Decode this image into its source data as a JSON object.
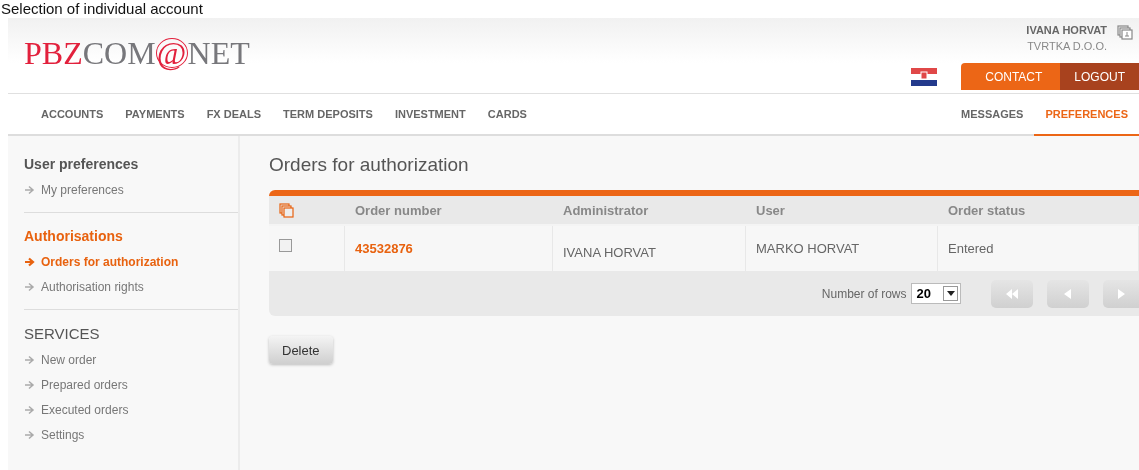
{
  "caption": "Selection of individual account",
  "logo": [
    {
      "text": "PBZ",
      "color": "#e2203c"
    },
    {
      "text": "COM",
      "color": "#77777b"
    },
    {
      "text": "@",
      "color": "#e2203c"
    },
    {
      "text": "NET",
      "color": "#77777b"
    }
  ],
  "user": {
    "name": "IVANA HORVAT",
    "company": "TVRTKA D.O.O."
  },
  "top_buttons": [
    {
      "label": "CONTACT",
      "kind": "contact"
    },
    {
      "label": "LOGOUT",
      "kind": "logout"
    }
  ],
  "nav_left": [
    {
      "label": "ACCOUNTS",
      "selected": false
    },
    {
      "label": "PAYMENTS",
      "selected": false
    },
    {
      "label": "FX DEALS",
      "selected": false
    },
    {
      "label": "TERM DEPOSITS",
      "selected": false
    },
    {
      "label": "INVESTMENT",
      "selected": false
    },
    {
      "label": "CARDS",
      "selected": false
    }
  ],
  "nav_right": [
    {
      "label": "MESSAGES",
      "selected": false
    },
    {
      "label": "PREFERENCES",
      "selected": true
    }
  ],
  "sidebar": [
    {
      "title": "User preferences",
      "selected": false,
      "items": [
        {
          "label": "My preferences",
          "selected": false
        }
      ]
    },
    {
      "title": "Authorisations",
      "selected": true,
      "items": [
        {
          "label": "Orders for authorization",
          "selected": true
        },
        {
          "label": "Authorisation rights",
          "selected": false
        }
      ]
    },
    {
      "title": "SERVICES",
      "selected": false,
      "items": [
        {
          "label": "New order",
          "selected": false
        },
        {
          "label": "Prepared orders",
          "selected": false
        },
        {
          "label": "Executed orders",
          "selected": false
        },
        {
          "label": "Settings",
          "selected": false
        }
      ]
    }
  ],
  "page_title": "Orders for authorization",
  "table": {
    "columns": [
      "Order number",
      "Administrator",
      "User",
      "Order status"
    ],
    "rows": [
      {
        "checked": false,
        "cells": [
          "43532876",
          "IVANA HORVAT",
          "MARKO HORVAT",
          "Entered"
        ]
      }
    ]
  },
  "pager": {
    "label": "Number of rows",
    "rows_value": "20"
  },
  "delete_button": "Delete"
}
